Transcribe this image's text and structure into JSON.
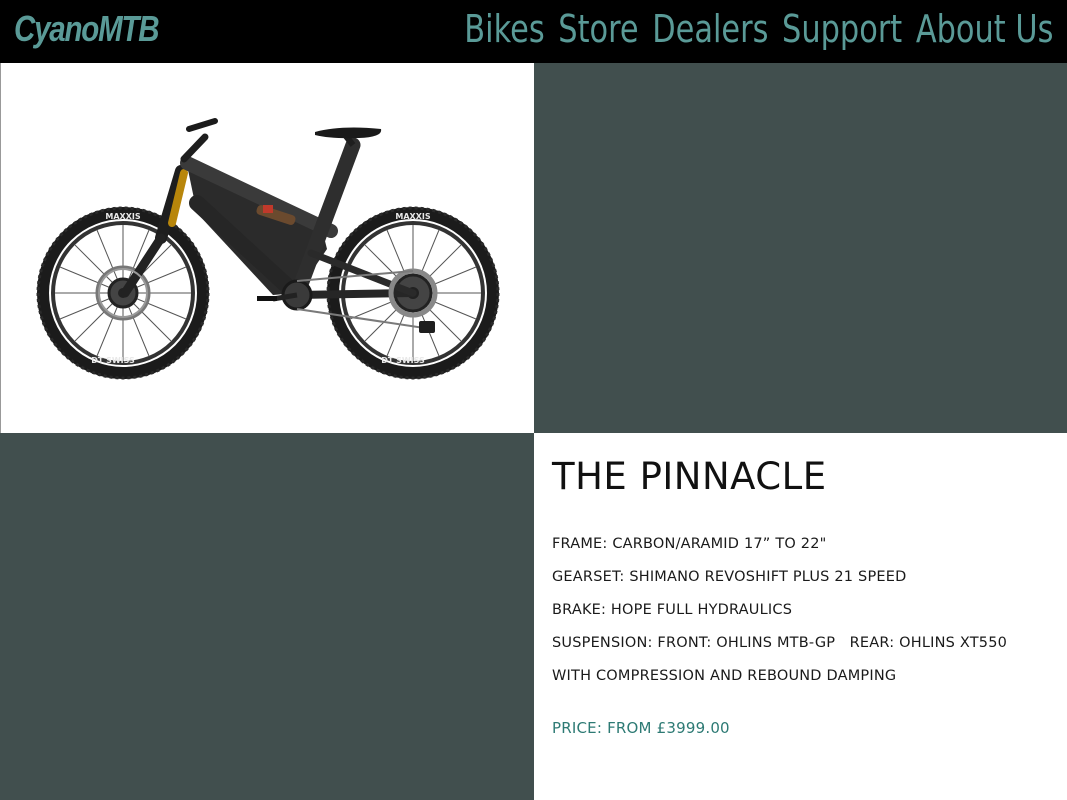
{
  "brand": {
    "logo_text": "CyanoMTB"
  },
  "nav": {
    "items": [
      {
        "label": "Bikes"
      },
      {
        "label": "Store"
      },
      {
        "label": "Dealers"
      },
      {
        "label": "Support"
      },
      {
        "label": "About Us"
      }
    ]
  },
  "product": {
    "image_alt": "Full suspension mountain bike",
    "tire_brand": "MAXXIS",
    "rim_brand": "DT SWISS",
    "title": "THE PINNACLE",
    "specs": [
      "FRAME: CARBON/ARAMID 17” TO 22\"",
      "GEARSET: SHIMANO REVOSHIFT PLUS 21 SPEED",
      "BRAKE: HOPE FULL HYDRAULICS",
      "SUSPENSION: FRONT: OHLINS MTB-GP   REAR: OHLINS XT550",
      "WITH COMPRESSION AND REBOUND DAMPING"
    ],
    "price": "PRICE: FROM £3999.00"
  },
  "colors": {
    "header_bg": "#000000",
    "accent": "#5a9a97",
    "panel_dark": "#414f4e",
    "price": "#2d7a74",
    "text": "#1a1a1a"
  }
}
